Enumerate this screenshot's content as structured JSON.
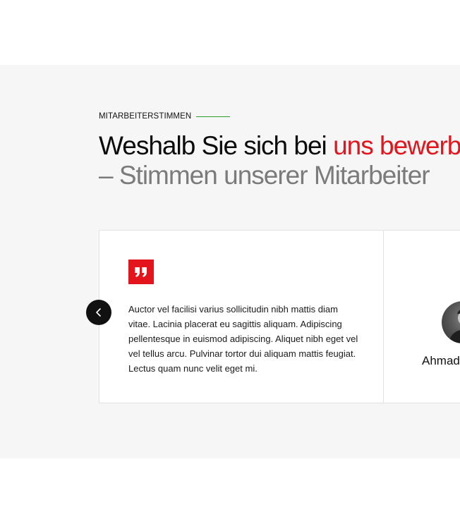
{
  "section": {
    "eyebrow": "MITARBEITERSTIMMEN",
    "heading_part1": "Weshalb Sie sich bei ",
    "heading_highlight": "uns bewerben",
    "heading_line2": "– Stimmen unserer Mitarbeiter"
  },
  "testimonials": [
    {
      "quote_icon": "quote-icon",
      "text": "Auctor vel facilisi varius sollicitudin nibh mattis diam vitae. Lacinia placerat eu sagittis aliquam. Adipiscing pellentesque in euismod adipiscing. Aliquet nibh eget vel vel tellus arcu. Pulvinar tortor dui aliquam mattis feugiat. Lectus quam nunc velit eget mi."
    },
    {
      "name": "Ahmad"
    }
  ],
  "controls": {
    "prev_icon": "chevron-left-icon"
  },
  "colors": {
    "accent": "#e3141c",
    "eyebrow_line": "#2a9d2a",
    "section_bg": "#f6f6f6",
    "muted_heading": "#7b7b7b"
  }
}
